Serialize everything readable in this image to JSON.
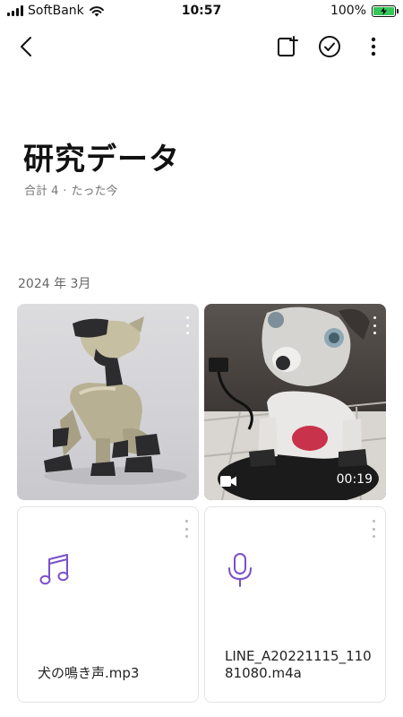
{
  "status_bar": {
    "carrier": "SoftBank",
    "time": "10:57",
    "battery": "100%",
    "battery_level": 1.0
  },
  "top_bar": {
    "icons": [
      "back-icon",
      "add-to-album-icon",
      "select-check-icon",
      "more-vertical-icon"
    ]
  },
  "album": {
    "title": "研究データ",
    "count_label": "合計 4",
    "separator": "·",
    "updated": "たった今"
  },
  "section": {
    "date": "2024 年 3月"
  },
  "items": [
    {
      "type": "photo",
      "subject": "robot dog (silver)"
    },
    {
      "type": "video",
      "duration": "00:19",
      "icon": "video-camera-icon"
    },
    {
      "type": "audio",
      "name": "犬の鳴き声.mp3",
      "icon": "music-note-icon"
    },
    {
      "type": "voice",
      "name": "LINE_A20221115_11081080.m4a",
      "icon": "microphone-icon"
    }
  ],
  "colors": {
    "accent_purple": "#7b4fc9",
    "battery_green": "#34c759",
    "meta_gray": "#777777"
  }
}
